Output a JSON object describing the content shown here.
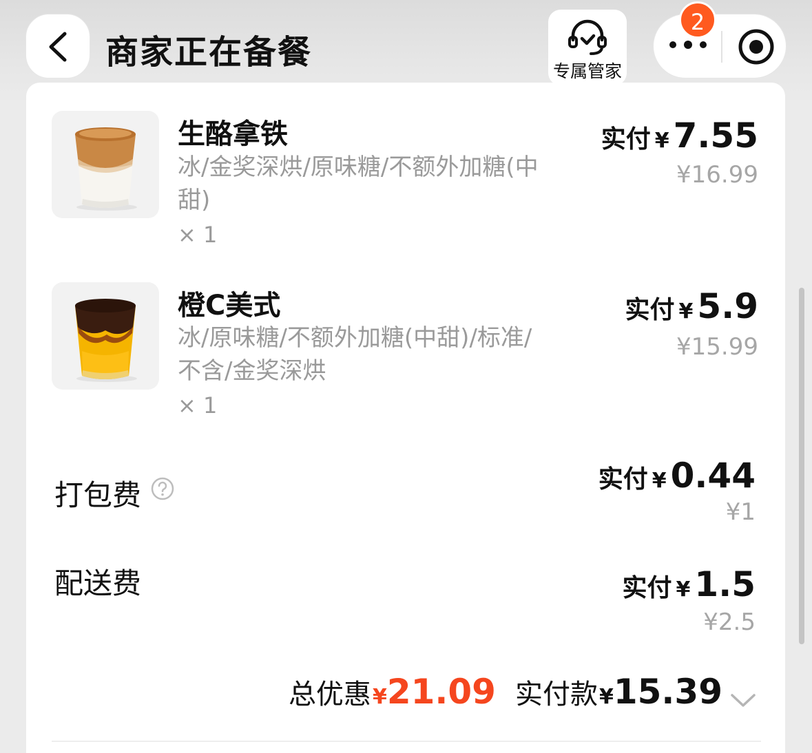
{
  "header": {
    "title": "商家正在备餐",
    "service_label": "专属管家",
    "badge_count": "2"
  },
  "items": [
    {
      "name": "生酪拿铁",
      "spec": "冰/金奖深烘/原味糖/不额外加糖(中甜)",
      "qty": "× 1",
      "paid_label": "实付",
      "currency": "¥",
      "paid_amount": "7.55",
      "original_price": "¥16.99",
      "image_icon": "latte-cup-image"
    },
    {
      "name": "橙C美式",
      "spec": "冰/原味糖/不额外加糖(中甜)/标准/不含/金奖深烘",
      "qty": "× 1",
      "paid_label": "实付",
      "currency": "¥",
      "paid_amount": "5.9",
      "original_price": "¥15.99",
      "image_icon": "orange-americano-cup-image"
    }
  ],
  "fees": {
    "packing": {
      "label": "打包费",
      "paid_label": "实付",
      "currency": "¥",
      "paid_amount": "0.44",
      "original_price": "¥1"
    },
    "delivery": {
      "label": "配送费",
      "paid_label": "实付",
      "currency": "¥",
      "paid_amount": "1.5",
      "original_price": "¥2.5"
    }
  },
  "summary": {
    "discount_label": "总优惠",
    "discount_currency": "¥",
    "discount_amount": "21.09",
    "paid_label": "实付款",
    "paid_currency": "¥",
    "paid_amount": "15.39"
  },
  "colors": {
    "accent_red": "#f5461e",
    "badge_orange": "#ff5a1f",
    "muted_text": "#9a9a9a"
  }
}
